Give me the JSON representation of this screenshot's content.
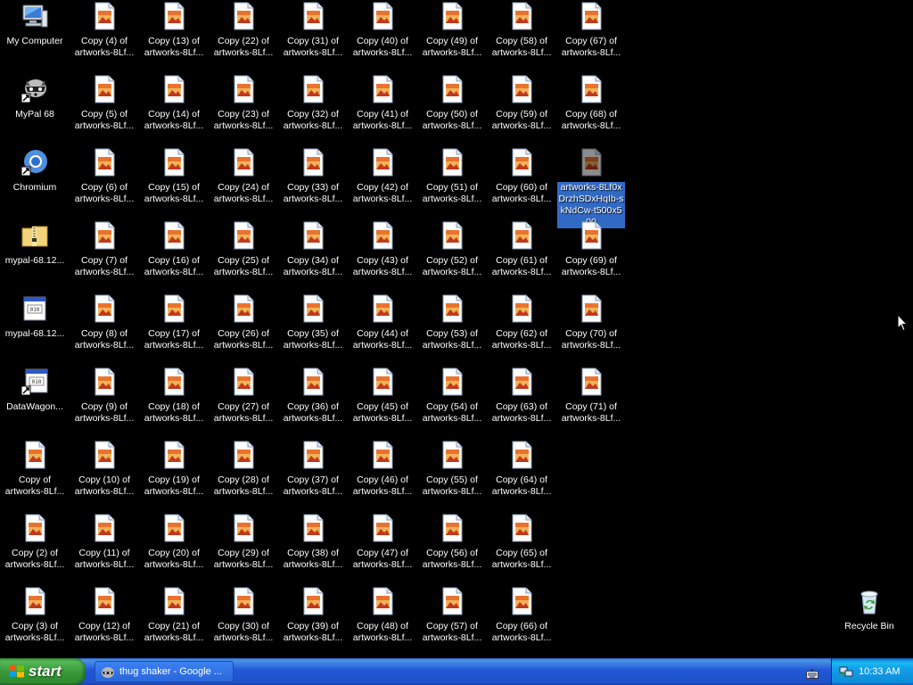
{
  "desktop": {
    "special_icons": [
      {
        "name": "my-computer",
        "label": "My Computer",
        "icon": "computer-icon",
        "col": 0,
        "row": 0
      },
      {
        "name": "mypal-68",
        "label": "MyPal 68",
        "icon": "raccoon-shortcut-icon",
        "col": 0,
        "row": 1
      },
      {
        "name": "chromium",
        "label": "Chromium",
        "icon": "chromium-shortcut-icon",
        "col": 0,
        "row": 2
      },
      {
        "name": "mypal-zip",
        "label": "mypal-68.12...",
        "icon": "zip-folder-icon",
        "col": 0,
        "row": 3
      },
      {
        "name": "mypal-file",
        "label": "mypal-68.12...",
        "icon": "binary-file-icon",
        "col": 0,
        "row": 4
      },
      {
        "name": "datawagon",
        "label": "DataWagon...",
        "icon": "binary-shortcut-icon",
        "col": 0,
        "row": 5
      },
      {
        "name": "artworks-original",
        "label": "artworks-8Lf0x\nDrzhSDxHqIb-s\nkNdCw-t500x5\n00",
        "icon": "image-file-icon",
        "col": 8,
        "row": 2,
        "selected": true
      }
    ],
    "copy_icons": [
      {
        "label": "Copy of\nartworks-8Lf...",
        "col": 0,
        "row": 6
      },
      {
        "label": "Copy (2) of\nartworks-8Lf...",
        "col": 0,
        "row": 7
      },
      {
        "label": "Copy (3) of\nartworks-8Lf...",
        "col": 0,
        "row": 8
      },
      {
        "label": "Copy (4) of\nartworks-8Lf...",
        "col": 1,
        "row": 0
      },
      {
        "label": "Copy (5) of\nartworks-8Lf...",
        "col": 1,
        "row": 1
      },
      {
        "label": "Copy (6) of\nartworks-8Lf...",
        "col": 1,
        "row": 2
      },
      {
        "label": "Copy (7) of\nartworks-8Lf...",
        "col": 1,
        "row": 3
      },
      {
        "label": "Copy (8) of\nartworks-8Lf...",
        "col": 1,
        "row": 4
      },
      {
        "label": "Copy (9) of\nartworks-8Lf...",
        "col": 1,
        "row": 5
      },
      {
        "label": "Copy (10) of\nartworks-8Lf...",
        "col": 1,
        "row": 6
      },
      {
        "label": "Copy (11) of\nartworks-8Lf...",
        "col": 1,
        "row": 7
      },
      {
        "label": "Copy (12) of\nartworks-8Lf...",
        "col": 1,
        "row": 8
      },
      {
        "label": "Copy (13) of\nartworks-8Lf...",
        "col": 2,
        "row": 0
      },
      {
        "label": "Copy (14) of\nartworks-8Lf...",
        "col": 2,
        "row": 1
      },
      {
        "label": "Copy (15) of\nartworks-8Lf...",
        "col": 2,
        "row": 2
      },
      {
        "label": "Copy (16) of\nartworks-8Lf...",
        "col": 2,
        "row": 3
      },
      {
        "label": "Copy (17) of\nartworks-8Lf...",
        "col": 2,
        "row": 4
      },
      {
        "label": "Copy (18) of\nartworks-8Lf...",
        "col": 2,
        "row": 5
      },
      {
        "label": "Copy (19) of\nartworks-8Lf...",
        "col": 2,
        "row": 6
      },
      {
        "label": "Copy (20) of\nartworks-8Lf...",
        "col": 2,
        "row": 7
      },
      {
        "label": "Copy (21) of\nartworks-8Lf...",
        "col": 2,
        "row": 8
      },
      {
        "label": "Copy (22) of\nartworks-8Lf...",
        "col": 3,
        "row": 0
      },
      {
        "label": "Copy (23) of\nartworks-8Lf...",
        "col": 3,
        "row": 1
      },
      {
        "label": "Copy (24) of\nartworks-8Lf...",
        "col": 3,
        "row": 2
      },
      {
        "label": "Copy (25) of\nartworks-8Lf...",
        "col": 3,
        "row": 3
      },
      {
        "label": "Copy (26) of\nartworks-8Lf...",
        "col": 3,
        "row": 4
      },
      {
        "label": "Copy (27) of\nartworks-8Lf...",
        "col": 3,
        "row": 5
      },
      {
        "label": "Copy (28) of\nartworks-8Lf...",
        "col": 3,
        "row": 6
      },
      {
        "label": "Copy (29) of\nartworks-8Lf...",
        "col": 3,
        "row": 7
      },
      {
        "label": "Copy (30) of\nartworks-8Lf...",
        "col": 3,
        "row": 8
      },
      {
        "label": "Copy (31) of\nartworks-8Lf...",
        "col": 4,
        "row": 0
      },
      {
        "label": "Copy (32) of\nartworks-8Lf...",
        "col": 4,
        "row": 1
      },
      {
        "label": "Copy (33) of\nartworks-8Lf...",
        "col": 4,
        "row": 2
      },
      {
        "label": "Copy (34) of\nartworks-8Lf...",
        "col": 4,
        "row": 3
      },
      {
        "label": "Copy (35) of\nartworks-8Lf...",
        "col": 4,
        "row": 4
      },
      {
        "label": "Copy (36) of\nartworks-8Lf...",
        "col": 4,
        "row": 5
      },
      {
        "label": "Copy (37) of\nartworks-8Lf...",
        "col": 4,
        "row": 6
      },
      {
        "label": "Copy (38) of\nartworks-8Lf...",
        "col": 4,
        "row": 7
      },
      {
        "label": "Copy (39) of\nartworks-8Lf...",
        "col": 4,
        "row": 8
      },
      {
        "label": "Copy (40) of\nartworks-8Lf...",
        "col": 5,
        "row": 0
      },
      {
        "label": "Copy (41) of\nartworks-8Lf...",
        "col": 5,
        "row": 1
      },
      {
        "label": "Copy (42) of\nartworks-8Lf...",
        "col": 5,
        "row": 2
      },
      {
        "label": "Copy (43) of\nartworks-8Lf...",
        "col": 5,
        "row": 3
      },
      {
        "label": "Copy (44) of\nartworks-8Lf...",
        "col": 5,
        "row": 4
      },
      {
        "label": "Copy (45) of\nartworks-8Lf...",
        "col": 5,
        "row": 5
      },
      {
        "label": "Copy (46) of\nartworks-8Lf...",
        "col": 5,
        "row": 6
      },
      {
        "label": "Copy (47) of\nartworks-8Lf...",
        "col": 5,
        "row": 7
      },
      {
        "label": "Copy (48) of\nartworks-8Lf...",
        "col": 5,
        "row": 8
      },
      {
        "label": "Copy (49) of\nartworks-8Lf...",
        "col": 6,
        "row": 0
      },
      {
        "label": "Copy (50) of\nartworks-8Lf...",
        "col": 6,
        "row": 1
      },
      {
        "label": "Copy (51) of\nartworks-8Lf...",
        "col": 6,
        "row": 2
      },
      {
        "label": "Copy (52) of\nartworks-8Lf...",
        "col": 6,
        "row": 3
      },
      {
        "label": "Copy (53) of\nartworks-8Lf...",
        "col": 6,
        "row": 4
      },
      {
        "label": "Copy (54) of\nartworks-8Lf...",
        "col": 6,
        "row": 5
      },
      {
        "label": "Copy (55) of\nartworks-8Lf...",
        "col": 6,
        "row": 6
      },
      {
        "label": "Copy (56) of\nartworks-8Lf...",
        "col": 6,
        "row": 7
      },
      {
        "label": "Copy (57) of\nartworks-8Lf...",
        "col": 6,
        "row": 8
      },
      {
        "label": "Copy (58) of\nartworks-8Lf...",
        "col": 7,
        "row": 0
      },
      {
        "label": "Copy (59) of\nartworks-8Lf...",
        "col": 7,
        "row": 1
      },
      {
        "label": "Copy (60) of\nartworks-8Lf...",
        "col": 7,
        "row": 2
      },
      {
        "label": "Copy (61) of\nartworks-8Lf...",
        "col": 7,
        "row": 3
      },
      {
        "label": "Copy (62) of\nartworks-8Lf...",
        "col": 7,
        "row": 4
      },
      {
        "label": "Copy (63) of\nartworks-8Lf...",
        "col": 7,
        "row": 5
      },
      {
        "label": "Copy (64) of\nartworks-8Lf...",
        "col": 7,
        "row": 6
      },
      {
        "label": "Copy (65) of\nartworks-8Lf...",
        "col": 7,
        "row": 7
      },
      {
        "label": "Copy (66) of\nartworks-8Lf...",
        "col": 7,
        "row": 8
      },
      {
        "label": "Copy (67) of\nartworks-8Lf...",
        "col": 8,
        "row": 0
      },
      {
        "label": "Copy (68) of\nartworks-8Lf...",
        "col": 8,
        "row": 1
      },
      {
        "label": "Copy (69) of\nartworks-8Lf...",
        "col": 8,
        "row": 3
      },
      {
        "label": "Copy (70) of\nartworks-8Lf...",
        "col": 8,
        "row": 4
      },
      {
        "label": "Copy (71) of\nartworks-8Lf...",
        "col": 8,
        "row": 5
      }
    ],
    "recycle_bin": {
      "label": "Recycle Bin",
      "icon": "recycle-bin-icon"
    }
  },
  "taskbar": {
    "start_label": "start",
    "task_label": "thug shaker - Google ...",
    "task_icon": "browser-raccoon-icon",
    "tray_icons": [
      "keyboard-icon",
      "network-icon"
    ],
    "clock": "10:33 AM"
  },
  "colors": {
    "desktop_bg": "#000000",
    "selection": "#316ac5",
    "taskbar_blue": "#245edb",
    "start_green": "#3a9a3a",
    "tray_blue": "#139ee9"
  }
}
